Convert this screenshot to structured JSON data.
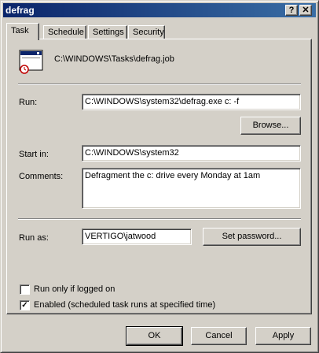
{
  "window": {
    "title": "defrag",
    "help_glyph": "?",
    "close_glyph": "✕"
  },
  "tabs": [
    {
      "label": "Task",
      "active": true
    },
    {
      "label": "Schedule",
      "active": false
    },
    {
      "label": "Settings",
      "active": false
    },
    {
      "label": "Security",
      "active": false
    }
  ],
  "task": {
    "path": "C:\\WINDOWS\\Tasks\\defrag.job",
    "run_label": "Run:",
    "run_value": "C:\\WINDOWS\\system32\\defrag.exe c: -f",
    "browse_label": "Browse...",
    "start_in_label": "Start in:",
    "start_in_value": "C:\\WINDOWS\\system32",
    "comments_label": "Comments:",
    "comments_value": "Defragment the c: drive every Monday at 1am",
    "run_as_label": "Run as:",
    "run_as_value": "VERTIGO\\jatwood",
    "set_password_label": "Set password...",
    "run_only_logged_on_label": "Run only if logged on",
    "run_only_logged_on_checked": false,
    "enabled_label": "Enabled (scheduled task runs at specified time)",
    "enabled_checked": true,
    "check_glyph": "✓"
  },
  "buttons": {
    "ok": "OK",
    "cancel": "Cancel",
    "apply": "Apply"
  }
}
